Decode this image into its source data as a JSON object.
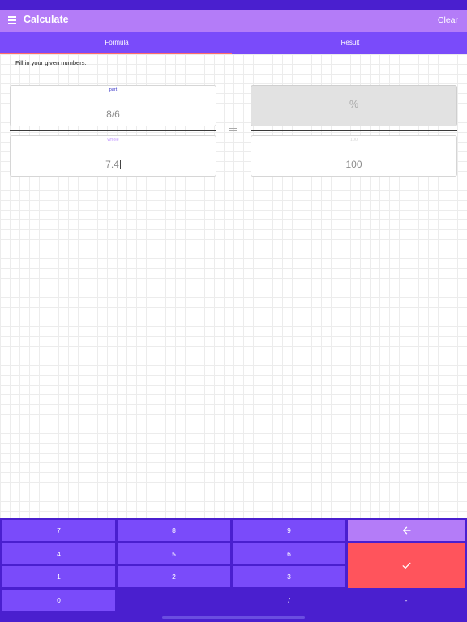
{
  "app_bar": {
    "title": "Calculate",
    "clear_label": "Clear"
  },
  "tabs": [
    {
      "label": "Formula",
      "active": true
    },
    {
      "label": "Result",
      "active": false
    }
  ],
  "content": {
    "instruction": "Fill in your given numbers:",
    "part": {
      "label": "part",
      "value": "8/6"
    },
    "whole": {
      "label": "whole",
      "value": "7.4"
    },
    "percent": {
      "value": "%"
    },
    "hundred": {
      "label": "100",
      "value": "100"
    },
    "equals": "="
  },
  "keypad": {
    "k7": "7",
    "k8": "8",
    "k9": "9",
    "k4": "4",
    "k5": "5",
    "k6": "6",
    "k1": "1",
    "k2": "2",
    "k3": "3",
    "k0": "0",
    "dot": ".",
    "slash": "/",
    "minus": "-",
    "backspace_icon": "arrow-left-icon",
    "confirm_icon": "check-icon"
  },
  "colors": {
    "status_bar": "#4a1fcf",
    "app_bar": "#b47cf8",
    "tab_bar": "#7a4bfa",
    "tab_indicator": "#ff6b6b",
    "key_light": "#7a4bfa",
    "key_dark": "#4a1fcf",
    "key_backspace": "#b47cf8",
    "key_confirm": "#ff545c"
  }
}
